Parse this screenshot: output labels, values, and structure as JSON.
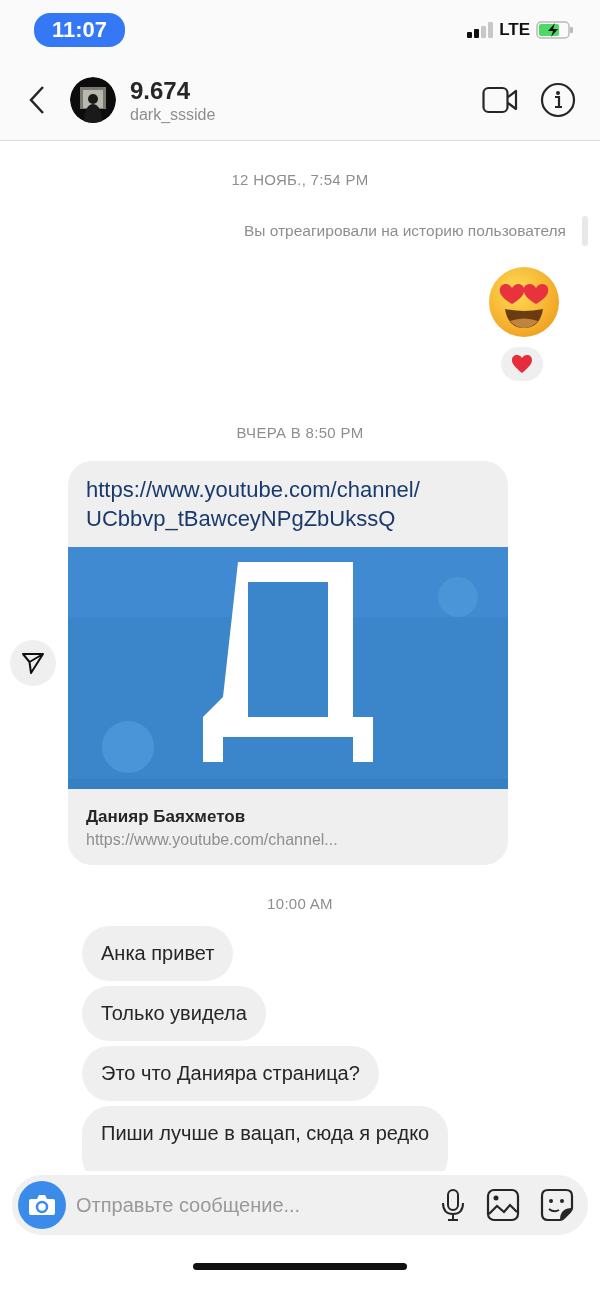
{
  "status_bar": {
    "time": "11:07",
    "network": "LTE"
  },
  "header": {
    "title": "9.674",
    "username": "dark_ssside"
  },
  "messages": [
    {
      "kind": "timestamp",
      "text": "12 НОЯБ., 7:54 PM"
    },
    {
      "kind": "note",
      "text": "Вы отреагировали на историю пользователя"
    },
    {
      "kind": "emoji",
      "reacted": true
    },
    {
      "kind": "timestamp",
      "text": "ВЧЕРА В 8:50 PM"
    },
    {
      "kind": "link",
      "url_lines": [
        "https://www.youtube.com/channel/",
        "UCbbvp_tBawceyNPgZbUkssQ"
      ],
      "preview": {
        "kind": "picture",
        "title": "Данияр Баяхметов",
        "subtitle": "https://www.youtube.com/channel..."
      }
    },
    {
      "kind": "timestamp",
      "text": "10:00 AM"
    },
    {
      "kind": "incoming",
      "text": "Анка привет"
    },
    {
      "kind": "incoming",
      "text": "Только увидела"
    },
    {
      "kind": "incoming",
      "text": "Это что Данияра страница?"
    },
    {
      "kind": "incoming",
      "text": "Пиши лучше в вацап, сюда я редко"
    }
  ],
  "composer": {
    "placeholder": "Отправьте сообщение..."
  }
}
